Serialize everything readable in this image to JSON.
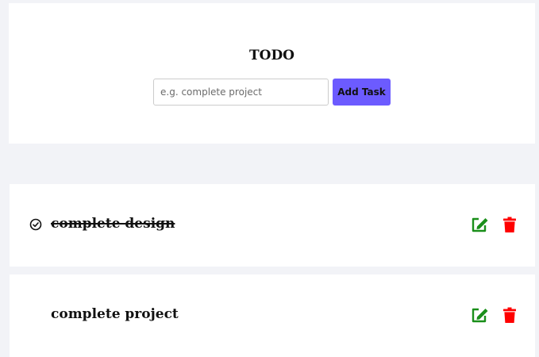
{
  "header": {
    "title": "TODO",
    "input_placeholder": "e.g. complete project",
    "input_value": "",
    "add_button_label": "Add Task"
  },
  "tasks": [
    {
      "text": "complete design",
      "completed": true,
      "icons": [
        "check-circle-icon",
        "edit-icon",
        "trash-icon"
      ]
    },
    {
      "text": "complete project",
      "completed": false,
      "icons": [
        "edit-icon",
        "trash-icon"
      ]
    }
  ],
  "colors": {
    "page_background": "#f2f3f7",
    "card_background": "#ffffff",
    "accent": "#6c5bff",
    "edit": "#1a8f1a",
    "delete": "#ff0000",
    "text": "#111111"
  }
}
